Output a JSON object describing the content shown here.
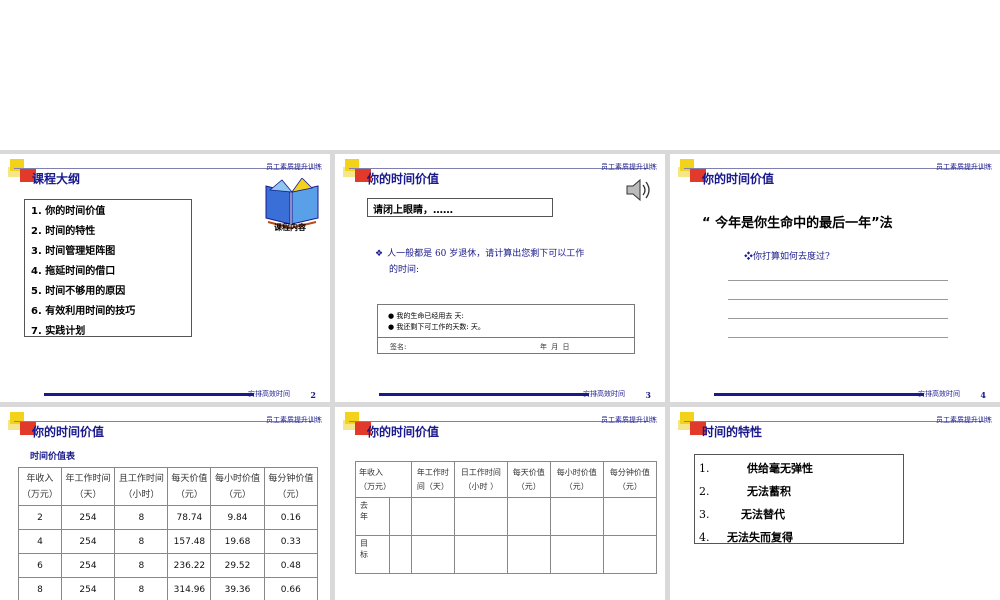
{
  "brand": "员工素质提升训练",
  "footer": "安排高效时间",
  "slides": [
    {
      "title": "课程大纲",
      "page": "2",
      "outline": [
        "1.  你的时间价值",
        "2.  时间的特性",
        "3.  时间管理矩阵图",
        "4.  拖延时间的借口",
        "5.  时间不够用的原因",
        "6.  有效利用时间的技巧",
        "7.  实践计划"
      ],
      "image_caption": "课程内容"
    },
    {
      "title": "你的时间价值",
      "page": "3",
      "prompt": "请闭上眼睛，……",
      "question_line1": "人一般都是 60 岁退休，请计算出您剩下可以工作",
      "question_line2": "的时间:",
      "form_line1": "●  我的生命已经用去        天:",
      "form_line2": "●  我还剩下可工作的天数:          天。",
      "form_sign": "签名:",
      "form_date": "年     月     日"
    },
    {
      "title": "你的时间价值",
      "page": "4",
      "headline": "“ 今年是你生命中的最后一年”法",
      "question": "❖你打算如何去度过?"
    },
    {
      "title": "你的时间价值",
      "table_caption": "时间价值表",
      "headers": [
        [
          "年收入",
          "（万元）"
        ],
        [
          "年工作时间",
          "（天）"
        ],
        [
          "且工作时间",
          "（小时）"
        ],
        [
          "每天价值",
          "（元）"
        ],
        [
          "每小时价值",
          "（元）"
        ],
        [
          "每分钟价值",
          "（元）"
        ]
      ],
      "rows": [
        [
          "2",
          "254",
          "8",
          "78.74",
          "9.84",
          "0.16"
        ],
        [
          "4",
          "254",
          "8",
          "157.48",
          "19.68",
          "0.33"
        ],
        [
          "6",
          "254",
          "8",
          "236.22",
          "29.52",
          "0.48"
        ],
        [
          "8",
          "254",
          "8",
          "314.96",
          "39.36",
          "0.66"
        ]
      ]
    },
    {
      "title": "你的时间价值",
      "headers": [
        [
          "年收入",
          "（万元）"
        ],
        [
          "年工作时",
          "间（天）"
        ],
        [
          "日工作时间",
          "（小时 ）"
        ],
        [
          "每天价值",
          "（元）"
        ],
        [
          "每小时价值",
          "（元）"
        ],
        [
          "每分钟价值",
          "（元）"
        ]
      ],
      "row_labels": [
        "去 年",
        "目 标"
      ]
    },
    {
      "title": "时间的特性",
      "traits": [
        {
          "num": "1.",
          "text": "供给毫无弹性"
        },
        {
          "num": "2.",
          "text": "无法蓄积"
        },
        {
          "num": "3.",
          "text": "无法替代"
        },
        {
          "num": "4.",
          "text": "无法失而复得"
        }
      ]
    }
  ]
}
